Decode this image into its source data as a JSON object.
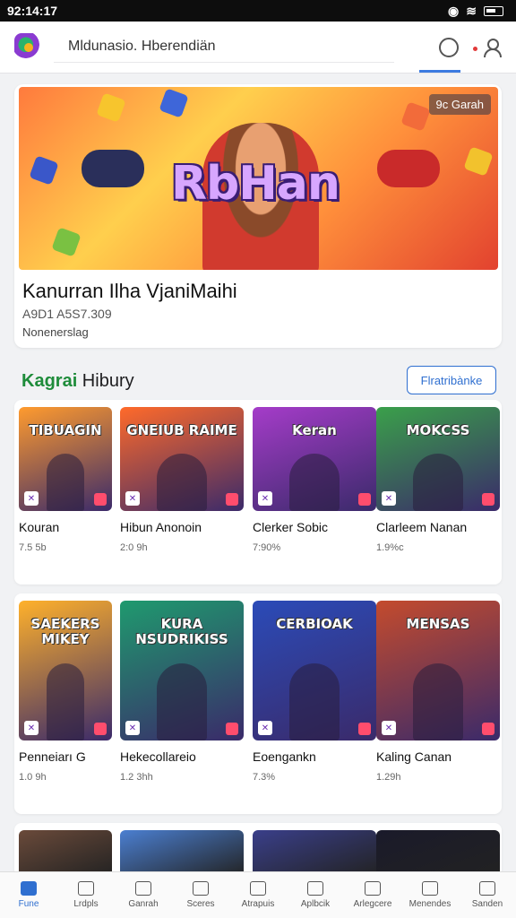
{
  "status": {
    "time": "92:14:17"
  },
  "header": {
    "search_text": "Mldunasio. Hberendiän",
    "icons": [
      "logo-icon",
      "chat-icon",
      "notification-dot",
      "user-icon"
    ],
    "accent_color": "#3c7be0"
  },
  "hero": {
    "badge": "9c Garah",
    "title": "Kanurran Ilha VjaniMaihi",
    "subtitle": "A9D1 A5S7.309",
    "caption": "Nonenerslag"
  },
  "section": {
    "title_accent": "Kagrai",
    "title_rest": " Hibury",
    "button_label": "Flratribànke"
  },
  "grid_rows": [
    [
      {
        "name": "Kouran",
        "meta": "7.5 5b",
        "art": "TIBUAGIN",
        "bg": "#ff9b2e"
      },
      {
        "name": "Hibun Anonoin",
        "meta": "2:0 9h",
        "art": "GNEIUB RAIME",
        "bg": "#ff6a2a"
      },
      {
        "name": "Clerker Sobic",
        "meta": "7:90%",
        "art": "Keran",
        "bg": "#a53cc9"
      },
      {
        "name": "Clarleem Nanan",
        "meta": "1.9%c",
        "art": "MOKCSS",
        "bg": "#3aa04a"
      }
    ],
    [
      {
        "name": "Penneiarı G",
        "meta": "1.0 9h",
        "art": "SAEKERS MIKEY",
        "bg": "#ffb12b"
      },
      {
        "name": "Hekecollareio",
        "meta": "1.2 3hh",
        "art": "KURA NSUDRIKISS",
        "bg": "#1f9a6e"
      },
      {
        "name": "Eoengankn",
        "meta": "7.3%",
        "art": "CERBIOAK",
        "bg": "#2b4bb8"
      },
      {
        "name": "Kaling Canan",
        "meta": "1.29h",
        "art": "MENSAS",
        "bg": "#c44b2d"
      }
    ]
  ],
  "nav": [
    {
      "label": "Fune",
      "active": true
    },
    {
      "label": "Lrdpls"
    },
    {
      "label": "Ganrah"
    },
    {
      "label": "Sceres"
    },
    {
      "label": "Atrapuis"
    },
    {
      "label": "Aplbcik"
    },
    {
      "label": "Arlegcere"
    },
    {
      "label": "Menendes"
    },
    {
      "label": "Sanden"
    }
  ]
}
